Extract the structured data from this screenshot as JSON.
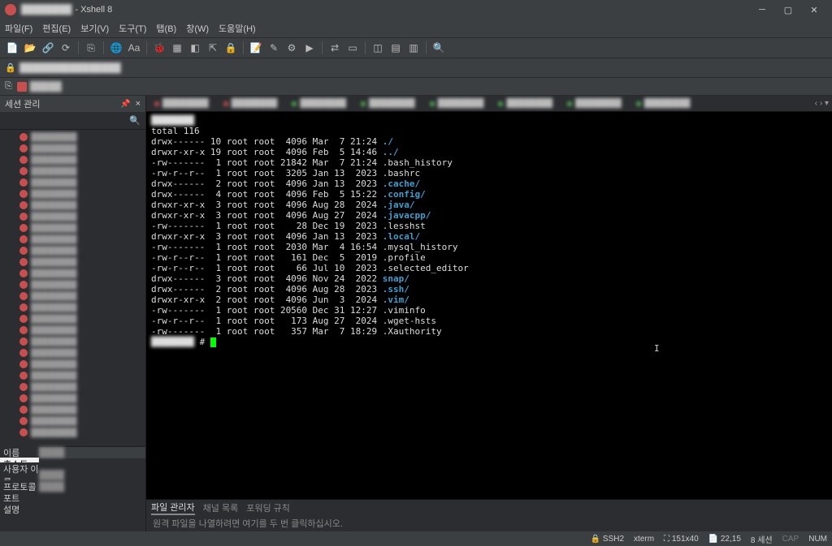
{
  "titlebar": {
    "blurred_prefix": "████████",
    "suffix": " - Xshell 8"
  },
  "menubar": [
    "파일(F)",
    "편집(E)",
    "보기(V)",
    "도구(T)",
    "탭(B)",
    "창(W)",
    "도움말(H)"
  ],
  "toolbar_icons": [
    "new-icon",
    "open-icon",
    "link-icon",
    "reload-icon",
    "sep",
    "copy-icon",
    "sep",
    "globe-icon",
    "font-icon",
    "sep",
    "bug-icon",
    "grid-icon",
    "app-icon",
    "detach-icon",
    "lock-icon",
    "sep",
    "note-icon",
    "edit-icon",
    "exec-icon",
    "play-icon",
    "sep",
    "transfer-icon",
    "layout-icon",
    "sep",
    "view1-icon",
    "view2-icon",
    "view3-icon",
    "sep",
    "search-icon"
  ],
  "addrbar": {
    "lock": "🔒",
    "addr": "████████████████"
  },
  "tab": {
    "name": "█████"
  },
  "sidebar": {
    "title": "세션 관리",
    "pin": "📌",
    "close": "×",
    "search_icon": "🔍",
    "tree_count": 27,
    "tree_label": "████████"
  },
  "props": {
    "rows": [
      {
        "label": "이름",
        "val": "████"
      },
      {
        "label": "호스트",
        "val": ""
      },
      {
        "label": "사용자 이름",
        "val": "████"
      },
      {
        "label": "프로토콜",
        "val": "████"
      },
      {
        "label": "포트",
        "val": ""
      },
      {
        "label": "설명",
        "val": ""
      }
    ]
  },
  "term_tabs_count": 8,
  "terminal": {
    "prompt_host": "████████",
    "total_line": "total 116",
    "prompt_char": "#",
    "lines": [
      {
        "perm": "drwx------",
        "links": "10",
        "owner": "root",
        "group": "root",
        "size": "4096",
        "date": "Mar  7 21:24",
        "name": "./",
        "dir": true
      },
      {
        "perm": "drwxr-xr-x",
        "links": "19",
        "owner": "root",
        "group": "root",
        "size": "4096",
        "date": "Feb  5 14:46",
        "name": "../",
        "dir": true
      },
      {
        "perm": "-rw-------",
        "links": "1",
        "owner": "root",
        "group": "root",
        "size": "21842",
        "date": "Mar  7 21:24",
        "name": ".bash_history",
        "dir": false
      },
      {
        "perm": "-rw-r--r--",
        "links": "1",
        "owner": "root",
        "group": "root",
        "size": "3205",
        "date": "Jan 13  2023",
        "name": ".bashrc",
        "dir": false
      },
      {
        "perm": "drwx------",
        "links": "2",
        "owner": "root",
        "group": "root",
        "size": "4096",
        "date": "Jan 13  2023",
        "name": ".cache/",
        "dir": true
      },
      {
        "perm": "drwx------",
        "links": "4",
        "owner": "root",
        "group": "root",
        "size": "4096",
        "date": "Feb  5 15:22",
        "name": ".config/",
        "dir": true
      },
      {
        "perm": "drwxr-xr-x",
        "links": "3",
        "owner": "root",
        "group": "root",
        "size": "4096",
        "date": "Aug 28  2024",
        "name": ".java/",
        "dir": true
      },
      {
        "perm": "drwxr-xr-x",
        "links": "3",
        "owner": "root",
        "group": "root",
        "size": "4096",
        "date": "Aug 27  2024",
        "name": ".javacpp/",
        "dir": true
      },
      {
        "perm": "-rw-------",
        "links": "1",
        "owner": "root",
        "group": "root",
        "size": "28",
        "date": "Dec 19  2023",
        "name": ".lesshst",
        "dir": false
      },
      {
        "perm": "drwxr-xr-x",
        "links": "3",
        "owner": "root",
        "group": "root",
        "size": "4096",
        "date": "Jan 13  2023",
        "name": ".local/",
        "dir": true
      },
      {
        "perm": "-rw-------",
        "links": "1",
        "owner": "root",
        "group": "root",
        "size": "2030",
        "date": "Mar  4 16:54",
        "name": ".mysql_history",
        "dir": false
      },
      {
        "perm": "-rw-r--r--",
        "links": "1",
        "owner": "root",
        "group": "root",
        "size": "161",
        "date": "Dec  5  2019",
        "name": ".profile",
        "dir": false
      },
      {
        "perm": "-rw-r--r--",
        "links": "1",
        "owner": "root",
        "group": "root",
        "size": "66",
        "date": "Jul 10  2023",
        "name": ".selected_editor",
        "dir": false
      },
      {
        "perm": "drwx------",
        "links": "3",
        "owner": "root",
        "group": "root",
        "size": "4096",
        "date": "Nov 24  2022",
        "name": "snap/",
        "dir": true
      },
      {
        "perm": "drwx------",
        "links": "2",
        "owner": "root",
        "group": "root",
        "size": "4096",
        "date": "Aug 28  2023",
        "name": ".ssh/",
        "dir": true
      },
      {
        "perm": "drwxr-xr-x",
        "links": "2",
        "owner": "root",
        "group": "root",
        "size": "4096",
        "date": "Jun  3  2024",
        "name": ".vim/",
        "dir": true
      },
      {
        "perm": "-rw-------",
        "links": "1",
        "owner": "root",
        "group": "root",
        "size": "20560",
        "date": "Dec 31 12:27",
        "name": ".viminfo",
        "dir": false
      },
      {
        "perm": "-rw-r--r--",
        "links": "1",
        "owner": "root",
        "group": "root",
        "size": "173",
        "date": "Aug 27  2024",
        "name": ".wget-hsts",
        "dir": false
      },
      {
        "perm": "-rw-------",
        "links": "1",
        "owner": "root",
        "group": "root",
        "size": "357",
        "date": "Mar  7 18:29",
        "name": ".Xauthority",
        "dir": false
      }
    ]
  },
  "bottom_tabs": [
    "파일 관리자",
    "채널 목록",
    "포워딩 규칙"
  ],
  "bottom_hint": "원격 파일을 나열하려면 여기를 두 번 클릭하십시오.",
  "statusbar": {
    "conn": "SSH2",
    "term": "xterm",
    "size": "151x40",
    "cursor": "22,15",
    "sessions": "8 세션",
    "caps": "CAP",
    "num": "NUM"
  }
}
